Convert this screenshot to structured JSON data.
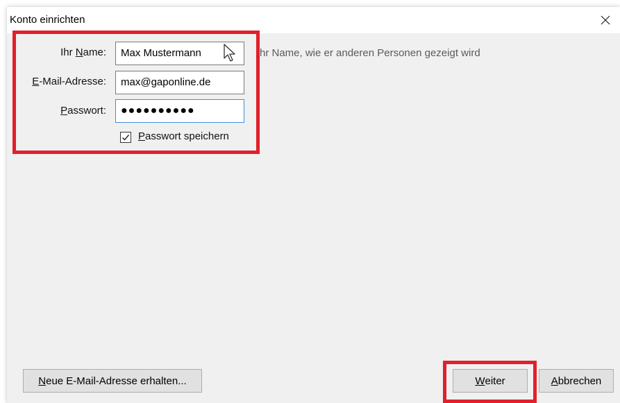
{
  "window": {
    "title": "Konto einrichten",
    "close_glyph": "✕"
  },
  "form": {
    "name": {
      "label_prefix": "Ihr ",
      "label_access": "N",
      "label_rest": "ame:",
      "value": "Max Mustermann",
      "hint": "hr Name, wie er anderen Personen gezeigt wird"
    },
    "email": {
      "label_access": "E",
      "label_rest": "-Mail-Adresse:",
      "value": "max@gaponline.de"
    },
    "password": {
      "label_access": "P",
      "label_rest": "asswort:",
      "value_masked": "●●●●●●●●●●"
    },
    "save_password": {
      "checked": true,
      "label_access": "P",
      "label_rest": "asswort speichern"
    }
  },
  "footer": {
    "new_address_access": "N",
    "new_address_rest": "eue E-Mail-Adresse erhalten...",
    "next_access": "W",
    "next_rest": "eiter",
    "cancel_access": "A",
    "cancel_rest": "bbrechen"
  },
  "colors": {
    "highlight": "#e0202b",
    "focus": "#3c8fd6",
    "dialog_bg": "#f0f0f0"
  }
}
